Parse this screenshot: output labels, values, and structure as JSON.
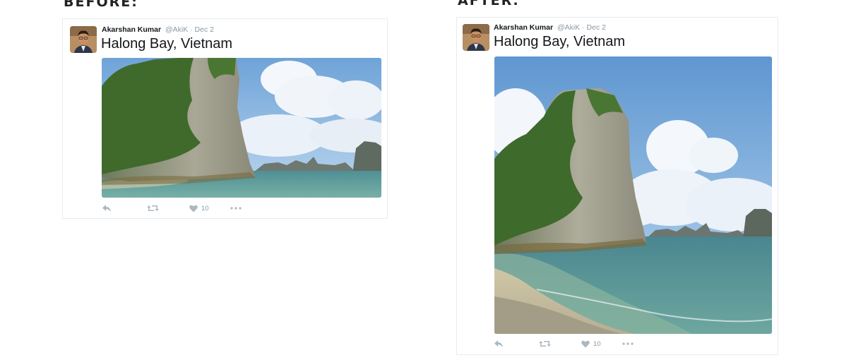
{
  "labels": {
    "before": "BEFORE:",
    "after": "AFTER:"
  },
  "tweet": {
    "name": "Akarshan Kumar",
    "handle": "@AkiK",
    "separator": "·",
    "date": "Dec 2",
    "text": "Halong Bay, Vietnam",
    "like_count": "10",
    "image": "photo-halong-bay-limestone-karst-island"
  },
  "colors": {
    "text_primary": "#14171a",
    "text_secondary": "#8899a6",
    "action_icon": "#aab8c2",
    "card_border": "#e6ecf0"
  },
  "icons": [
    "reply-icon",
    "retweet-icon",
    "heart-icon",
    "more-icon"
  ]
}
